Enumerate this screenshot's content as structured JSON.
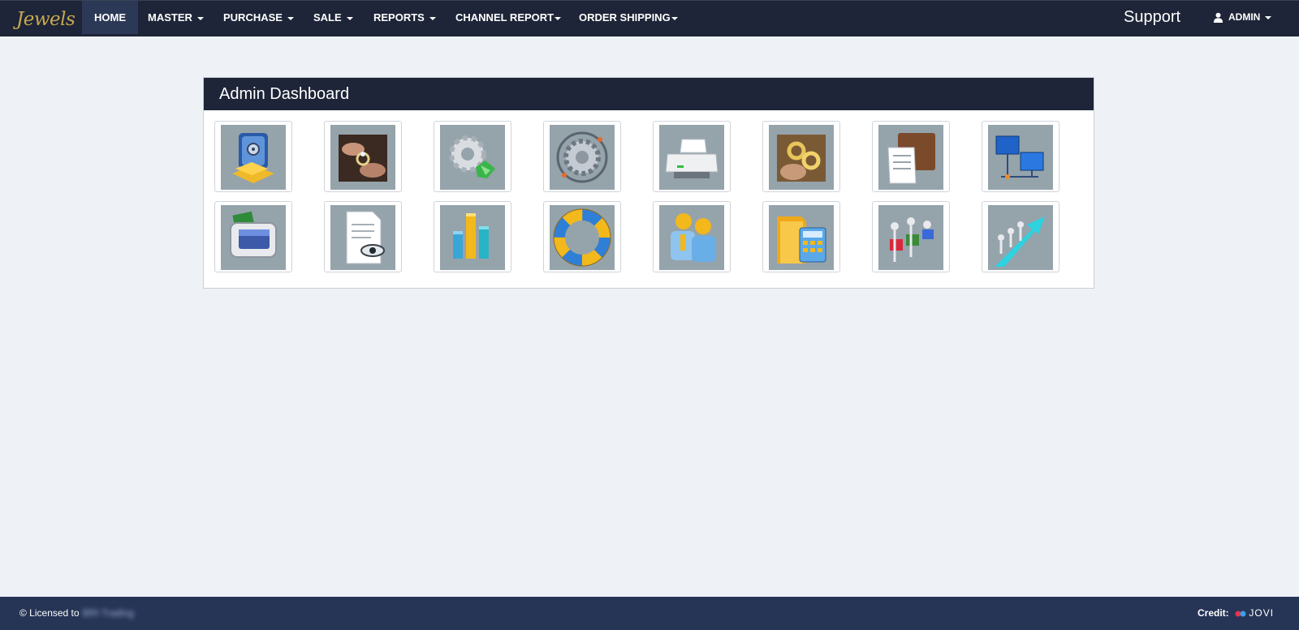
{
  "brand": {
    "name": "Jewels"
  },
  "nav": {
    "items": [
      {
        "label": "HOME",
        "active": true,
        "dropdown": false
      },
      {
        "label": "MASTER",
        "dropdown": true
      },
      {
        "label": "PURCHASE",
        "dropdown": true
      },
      {
        "label": "SALE",
        "dropdown": true
      },
      {
        "label": "REPORTS",
        "dropdown": true
      },
      {
        "label": "CHANNEL REPORT",
        "dropdown": true
      },
      {
        "label": "ORDER SHIPPING",
        "dropdown": true
      }
    ],
    "support_label": "Support",
    "user_label": "ADMIN"
  },
  "dashboard": {
    "title": "Admin Dashboard",
    "tiles": [
      {
        "icon": "safe-gold-icon"
      },
      {
        "icon": "jeweler-hands-icon"
      },
      {
        "icon": "gear-recycle-icon"
      },
      {
        "icon": "target-gear-icon"
      },
      {
        "icon": "printer-icon"
      },
      {
        "icon": "gold-rings-icon"
      },
      {
        "icon": "wallet-invoice-icon"
      },
      {
        "icon": "network-computers-icon"
      },
      {
        "icon": "money-wallet-icon"
      },
      {
        "icon": "document-view-icon"
      },
      {
        "icon": "bar-chart-icon"
      },
      {
        "icon": "lifebuoy-icon"
      },
      {
        "icon": "users-icon"
      },
      {
        "icon": "folder-calculator-icon"
      },
      {
        "icon": "team-puzzle-icon"
      },
      {
        "icon": "team-growth-arrow-icon"
      }
    ]
  },
  "footer": {
    "licensed_prefix": "© Licensed to",
    "licensee": "BRI Trading",
    "credit_label": "Credit:",
    "credit_brand": "JOVI"
  },
  "colors": {
    "navbar_bg": "#1e2538",
    "active_nav_bg": "#2c3956",
    "brand_gold": "#c8a94f",
    "page_bg": "#eef1f5",
    "tile_bg": "#95a3ab",
    "footer_bg": "#263556"
  }
}
